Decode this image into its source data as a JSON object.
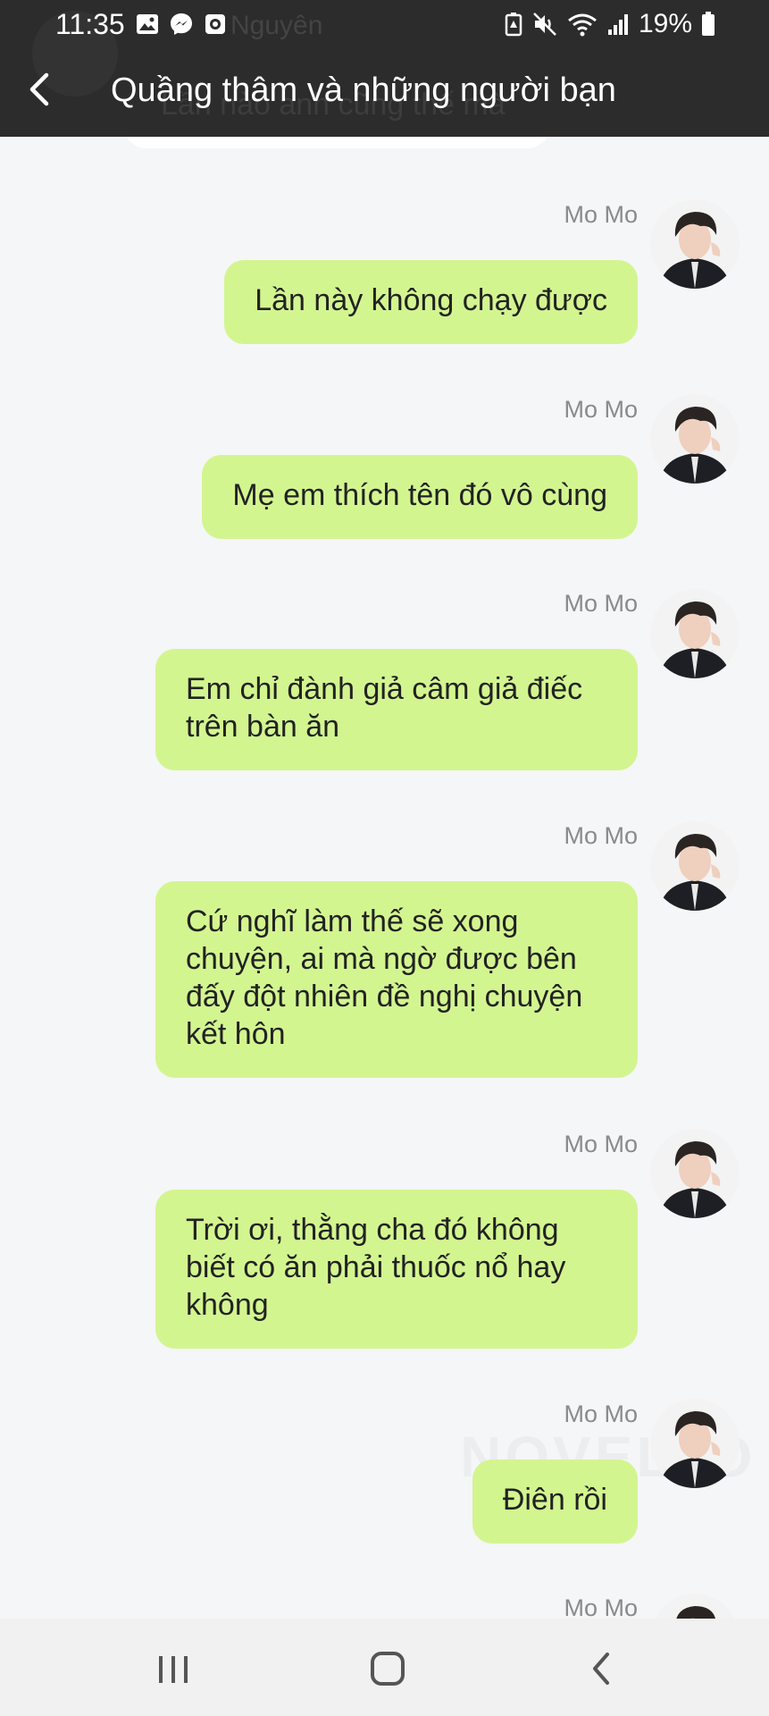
{
  "status_bar": {
    "time": "11:35",
    "battery": "19%",
    "icons_left": [
      "image-icon",
      "messenger-icon",
      "camera-app-icon"
    ],
    "icons_right": [
      "battery-saver-icon",
      "mute-icon",
      "wifi-icon",
      "signal-icon",
      "battery-icon"
    ]
  },
  "header": {
    "title": "Quầng thâm và những người bạn",
    "back_icon": "chevron-left-icon",
    "behind_name": "Nguyên",
    "behind_text": "Lần nào anh cũng thế mà"
  },
  "messages": [
    {
      "sender": "Mo Mo",
      "text": "Lần này không chạy được"
    },
    {
      "sender": "Mo Mo",
      "text": "Mẹ em thích tên đó vô cùng"
    },
    {
      "sender": "Mo Mo",
      "text": "Em chỉ đành giả câm giả điếc\ntrên bàn ăn"
    },
    {
      "sender": "Mo Mo",
      "text": "Cứ nghĩ làm thế sẽ xong\nchuyện, ai mà ngờ được bên\nđấy đột nhiên đề nghị chuyện\nkết hôn"
    },
    {
      "sender": "Mo Mo",
      "text": "Trời ơi, thằng cha đó không\nbiết có ăn phải thuốc nổ hay\nkhông"
    },
    {
      "sender": "Mo Mo",
      "text": "Điên rồi"
    },
    {
      "sender": "Mo Mo",
      "text": ""
    }
  ],
  "watermark": "NOVELTO",
  "colors": {
    "header_bg": "#2c2c2c",
    "chat_bg": "#f5f6f8",
    "bubble_bg": "#d3f590",
    "sender_text": "#8a8a8a",
    "navbar_bg": "#f1f1f1"
  },
  "navigation": {
    "buttons": [
      "recent-apps-icon",
      "home-icon",
      "back-icon"
    ]
  }
}
